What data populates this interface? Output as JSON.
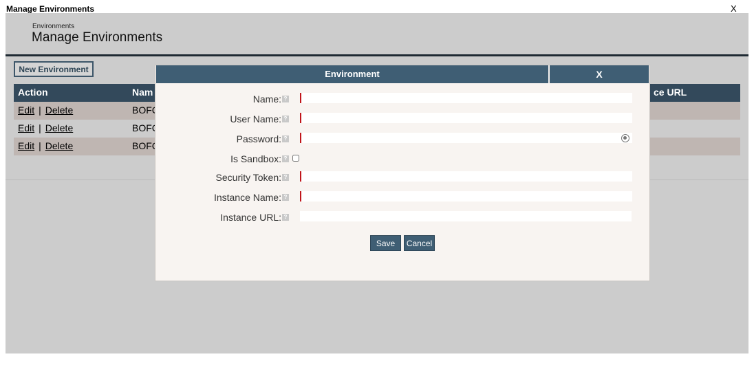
{
  "window": {
    "title": "Manage Environments",
    "close": "X"
  },
  "page": {
    "breadcrumb": "Environments",
    "title": "Manage Environments"
  },
  "toolbar": {
    "new_environment": "New Environment"
  },
  "table": {
    "headers": [
      "Action",
      "Nam",
      "ce URL"
    ],
    "rows": [
      {
        "edit": "Edit",
        "sep": "|",
        "delete": "Delete",
        "name": "BOFC"
      },
      {
        "edit": "Edit",
        "sep": "|",
        "delete": "Delete",
        "name": "BOFC"
      },
      {
        "edit": "Edit",
        "sep": "|",
        "delete": "Delete",
        "name": "BOFC"
      }
    ]
  },
  "modal": {
    "title": "Environment",
    "close": "X",
    "help_glyph": "?",
    "fields": {
      "name": {
        "label": "Name:",
        "value": ""
      },
      "user_name": {
        "label": "User Name:",
        "value": ""
      },
      "password": {
        "label": "Password:",
        "value": ""
      },
      "is_sandbox": {
        "label": "Is Sandbox:"
      },
      "security_token": {
        "label": "Security Token:",
        "value": ""
      },
      "instance_name": {
        "label": "Instance Name:",
        "value": ""
      },
      "instance_url": {
        "label": "Instance URL:",
        "value": ""
      }
    },
    "save": "Save",
    "cancel": "Cancel"
  },
  "colors": {
    "header_bg": "#33495b",
    "modal_header_bg": "#3f5e74",
    "required_marker": "#c0151b",
    "row_alt_bg": "#bfb6b2",
    "overlay_bg": "#cccccc"
  }
}
